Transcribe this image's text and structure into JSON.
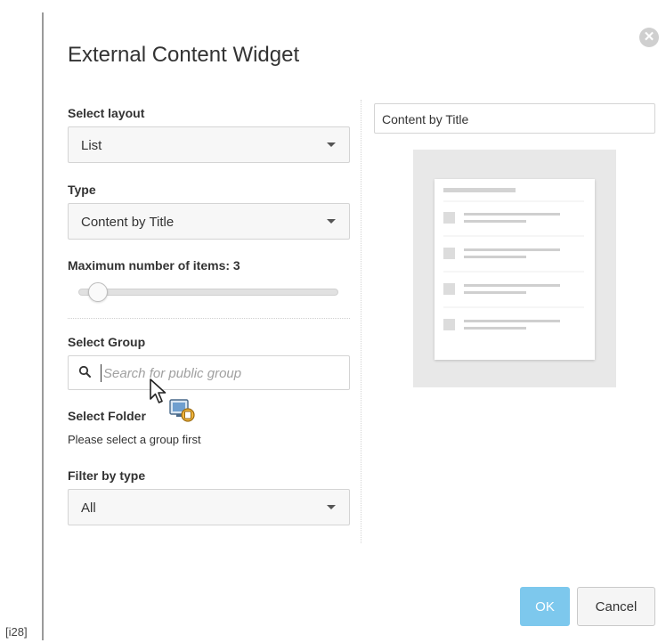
{
  "corner_label": "[i28]",
  "dialog": {
    "title": "External Content Widget",
    "close_icon": "close-icon"
  },
  "form": {
    "layout": {
      "label": "Select layout",
      "value": "List"
    },
    "type": {
      "label": "Type",
      "value": "Content by Title"
    },
    "max_items": {
      "label": "Maximum number of items: 3",
      "value": 3
    },
    "group": {
      "label": "Select Group",
      "placeholder": "Search for public group",
      "icon": "search-icon"
    },
    "folder": {
      "label": "Select Folder",
      "hint": "Please select a group first"
    },
    "filter": {
      "label": "Filter by type",
      "value": "All"
    }
  },
  "preview": {
    "title_value": "Content by Title",
    "item_count": 4
  },
  "buttons": {
    "ok": "OK",
    "cancel": "Cancel"
  },
  "colors": {
    "ok_button": "#7dc8ed",
    "close_button": "#cfcfcf",
    "preview_background": "#e8e8e8"
  }
}
